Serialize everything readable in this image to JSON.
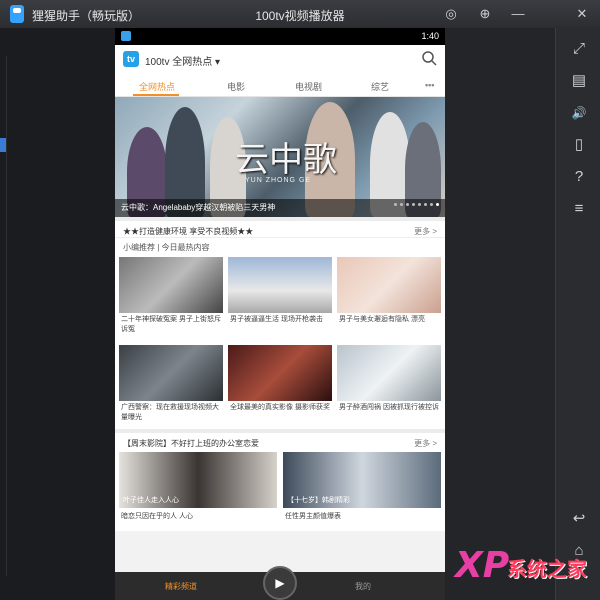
{
  "titlebar": {
    "app_name": "狸猩助手（畅玩版）",
    "window_title": "100tv视频播放器",
    "buttons": [
      "◎",
      "⊕",
      "—",
      "✕"
    ]
  },
  "sidebar": {
    "icons": [
      "fullscreen-icon",
      "keyboard-icon",
      "volume-icon",
      "rotate-icon",
      "help-icon",
      "menu-icon",
      "back-icon",
      "home-icon"
    ],
    "glyphs": [
      "⤢",
      "▤",
      "🔊",
      "▯",
      "?",
      "≡",
      "↩",
      "⌂"
    ]
  },
  "phone": {
    "status_time": "1:40",
    "header_title": "100tv 全网热点 ▾",
    "tabs": [
      "全网热点",
      "电影",
      "电视剧",
      "综艺",
      "•••"
    ],
    "banner": {
      "caption": "云中歌：Angelababy穿越汉朝被陷三天男神",
      "logo_text": "云中歌",
      "logo_sub": "YUN ZHONG GE",
      "dot_count": 8,
      "active_dot": 7
    },
    "section1": {
      "title": "★★打造健康环境 享受不良视频★★",
      "more": "更多 >",
      "subhead": "小编推荐 | 今日最热内容",
      "cards": [
        {
          "title": "二十年神探破冤案 男子上街怒斥诉冤"
        },
        {
          "title": "男子被逼逼生活 现场开枪袭击"
        },
        {
          "title": "男子与美女邂逅有隐私 漂亮"
        },
        {
          "title": "广西警察：现在救援现场视频大量曝光"
        },
        {
          "title": "全球最美的真实影像 摄影师获奖"
        },
        {
          "title": "男子醉酒闯祸 因被抓现行被控诉"
        }
      ]
    },
    "section2": {
      "title": "【周末影院】不好打上班的办公室恋爱",
      "more": "更多 >",
      "cards": [
        {
          "title": "暗恋只因在乎的人 人心",
          "overlay": "叶子佳人走入人心"
        },
        {
          "title": "任性男主颜值爆表",
          "overlay": "【十七岁】韩剧精彩"
        }
      ]
    },
    "bottomnav": {
      "left": "精彩频道",
      "right": "我的",
      "play": "▶"
    }
  },
  "watermark": {
    "xp": "XP",
    "site": "系统之家"
  },
  "colors": {
    "accent": "#f0902a",
    "phone_bg": "#f2f2f2",
    "chrome": "#2b2d31"
  }
}
